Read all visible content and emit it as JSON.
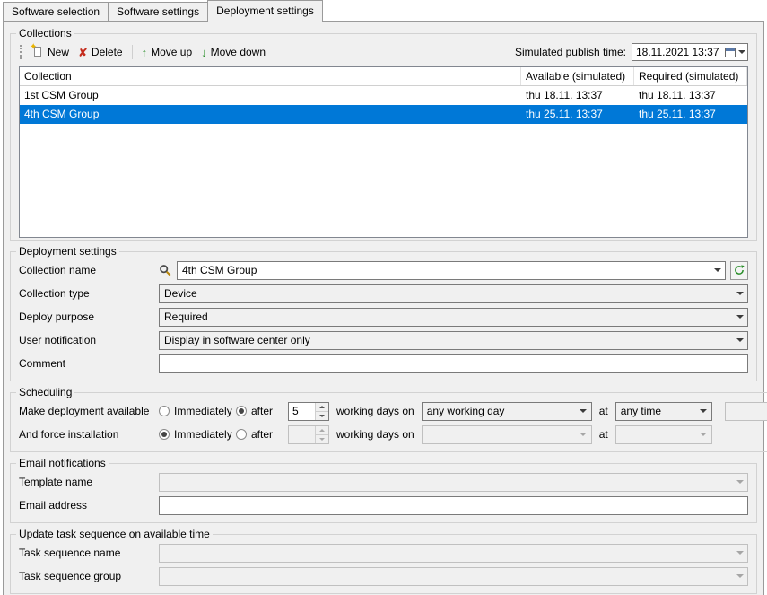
{
  "tabs": [
    {
      "label": "Software selection"
    },
    {
      "label": "Software settings"
    },
    {
      "label": "Deployment settings"
    }
  ],
  "collections": {
    "group_label": "Collections",
    "toolbar": {
      "new_label": "New",
      "delete_label": "Delete",
      "move_up_label": "Move up",
      "move_down_label": "Move down",
      "publish_time_label": "Simulated publish time:",
      "publish_time_value": "18.11.2021 13:37"
    },
    "table": {
      "columns": [
        "Collection",
        "Available (simulated)",
        "Required (simulated)"
      ],
      "rows": [
        {
          "collection": "1st CSM Group",
          "available": "thu 18.11. 13:37",
          "required": "thu 18.11. 13:37",
          "selected": false
        },
        {
          "collection": "4th CSM Group",
          "available": "thu 25.11. 13:37",
          "required": "thu 25.11. 13:37",
          "selected": true
        }
      ]
    }
  },
  "deployment": {
    "group_label": "Deployment settings",
    "collection_name_label": "Collection name",
    "collection_name_value": "4th CSM Group",
    "collection_type_label": "Collection type",
    "collection_type_value": "Device",
    "deploy_purpose_label": "Deploy purpose",
    "deploy_purpose_value": "Required",
    "user_notification_label": "User notification",
    "user_notification_value": "Display in software center only",
    "comment_label": "Comment",
    "comment_value": ""
  },
  "scheduling": {
    "group_label": "Scheduling",
    "available_row": {
      "label": "Make deployment available",
      "immediately_label": "Immediately",
      "after_label": "after",
      "immediately_selected": false,
      "after_selected": true,
      "days_value": "5",
      "working_days_label": "working days on",
      "day_value": "any working day",
      "at_label": "at",
      "time_value": "any time",
      "trailing_value": ""
    },
    "force_row": {
      "label": "And force installation",
      "immediately_label": "Immediately",
      "after_label": "after",
      "immediately_selected": true,
      "after_selected": false,
      "days_value": "",
      "working_days_label": "working days on",
      "day_value": "",
      "at_label": "at",
      "time_value": ""
    }
  },
  "email": {
    "group_label": "Email notifications",
    "template_label": "Template name",
    "template_value": "",
    "address_label": "Email address",
    "address_value": ""
  },
  "task_sequence": {
    "group_label": "Update task sequence on available time",
    "name_label": "Task sequence name",
    "name_value": "",
    "group_field_label": "Task sequence group",
    "group_field_value": ""
  },
  "colors": {
    "selection": "#0078d7",
    "background": "#f0f0f0"
  }
}
